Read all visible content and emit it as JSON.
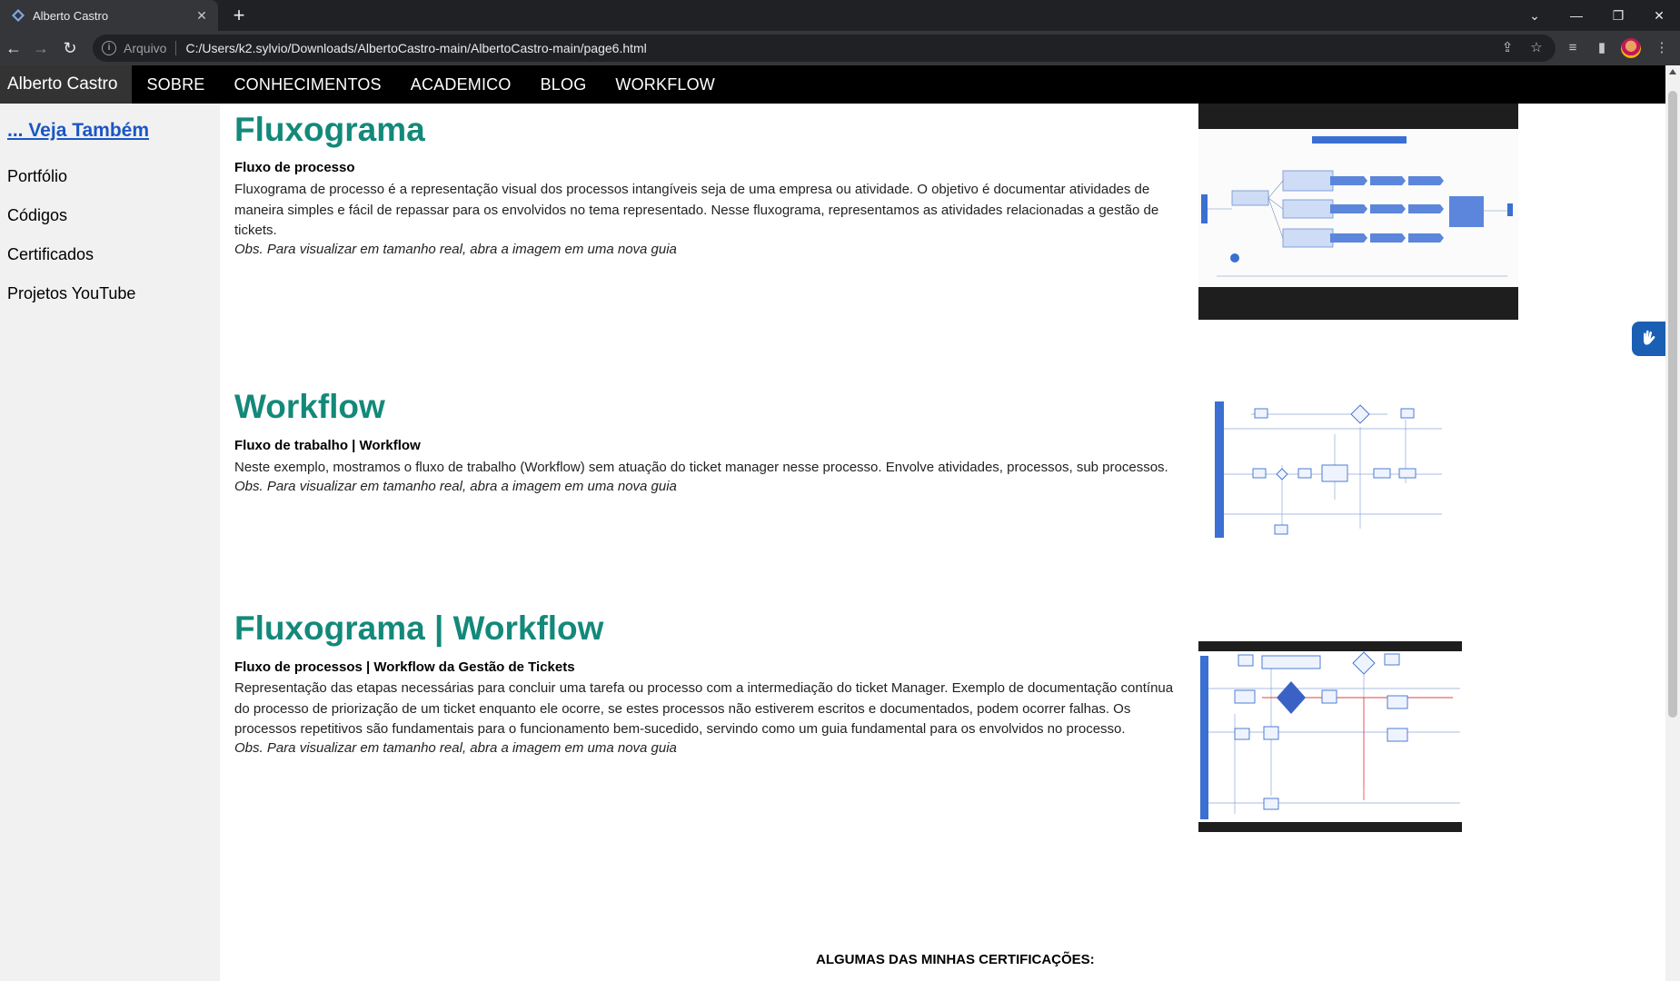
{
  "browser": {
    "tab_title": "Alberto Castro",
    "new_tab_symbol": "+",
    "close_symbol": "✕",
    "scheme_label": "Arquivo",
    "url": "C:/Users/k2.sylvio/Downloads/AlbertoCastro-main/AlbertoCastro-main/page6.html"
  },
  "sitenav": {
    "brand": "Alberto Castro",
    "links": [
      "SOBRE",
      "CONHECIMENTOS",
      "ACADEMICO",
      "BLOG",
      "WORKFLOW"
    ]
  },
  "sidebar": {
    "heading": "... Veja Também",
    "items": [
      "Portfólio",
      "Códigos",
      "Certificados",
      "Projetos YouTube"
    ]
  },
  "sections": [
    {
      "title": "Fluxograma",
      "subtitle": "Fluxo de processo",
      "body": "Fluxograma de processo é a representação visual dos processos intangíveis seja de uma empresa ou atividade. O objetivo é documentar atividades de maneira simples e fácil de repassar para os envolvidos no tema representado. Nesse fluxograma, representamos as atividades relacionadas a gestão de tickets.",
      "note": "Obs. Para visualizar em tamanho real, abra a imagem em uma nova guia"
    },
    {
      "title": "Workflow",
      "subtitle": "Fluxo de trabalho | Workflow",
      "body": "Neste exemplo, mostramos o fluxo de trabalho (Workflow) sem atuação do ticket manager nesse processo. Envolve atividades, processos, sub processos.",
      "note": "Obs. Para visualizar em tamanho real, abra a imagem em uma nova guia"
    },
    {
      "title": "Fluxograma | Workflow",
      "subtitle": "Fluxo de processos | Workflow da Gestão de Tickets",
      "body": "Representação das etapas necessárias para concluir uma tarefa ou processo com a intermediação do ticket Manager. Exemplo de documentação contínua do processo de priorização de um ticket enquanto ele ocorre, se estes processos não estiverem escritos e documentados, podem ocorrer falhas. Os processos repetitivos são fundamentais para o funcionamento bem-sucedido, servindo como um guia fundamental para os envolvidos no processo.",
      "note": "Obs. Para visualizar em tamanho real, abra a imagem em uma nova guia"
    }
  ],
  "certs_heading": "ALGUMAS DAS MINHAS CERTIFICAÇÕES:",
  "colors": {
    "accent_title": "#13897a",
    "nav_bg": "#000000",
    "brand_bg": "#333333",
    "sidebar_bg": "#f1f1f1",
    "link": "#1a56c4"
  }
}
